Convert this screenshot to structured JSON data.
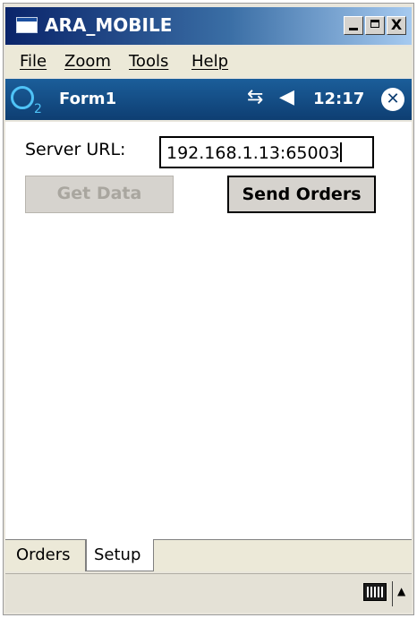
{
  "window": {
    "title": "ARA_MOBILE",
    "minimize_icon": "minimize-icon",
    "maximize_icon": "maximize-icon",
    "close_label": "X"
  },
  "menu": {
    "items": [
      {
        "label": "File"
      },
      {
        "label": "Zoom"
      },
      {
        "label": "Tools"
      },
      {
        "label": "Help"
      }
    ]
  },
  "status_bar": {
    "logo": "O2",
    "logo_sub": "2",
    "form_title": "Form1",
    "time": "12:17",
    "signal_icon": "signal-icon",
    "speaker_icon": "speaker-icon",
    "close_symbol": "✕"
  },
  "form": {
    "server_url_label": "Server URL:",
    "server_url_value": "192.168.1.13:65003",
    "get_data_label": "Get Data",
    "get_data_enabled": false,
    "send_orders_label": "Send Orders",
    "send_orders_enabled": true
  },
  "tabs": [
    {
      "label": "Orders",
      "selected": false
    },
    {
      "label": "Setup",
      "selected": true
    }
  ],
  "bottom_bar": {
    "keyboard_icon": "keyboard-icon",
    "sip_arrow": "▲"
  }
}
